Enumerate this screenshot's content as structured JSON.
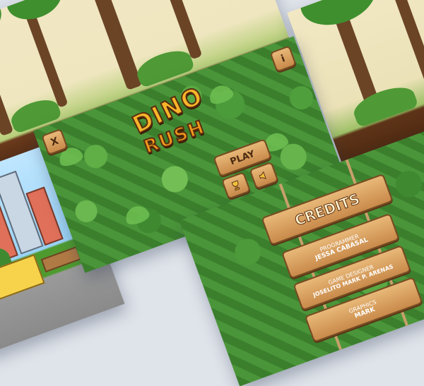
{
  "game": {
    "title_line1": "DINO",
    "title_line2": "RUSH",
    "play_label": "PLAY",
    "info_label": "i",
    "close_label": "X",
    "trophy_icon": "trophy-icon",
    "sound_icon": "speaker-icon"
  },
  "credits": {
    "title": "CREDITS",
    "role1": "PROGRAMMER",
    "name1": "JESSA CABASAL",
    "role2": "GAME DESIGNER",
    "name2": "JOSELITO MARK P. ARENAS",
    "role3": "GRAPHICS",
    "name3": "MARK"
  },
  "colors": {
    "leaf_green": "#4a9539",
    "wood": "#c98a4a",
    "title_orange": "#f7b52a"
  }
}
